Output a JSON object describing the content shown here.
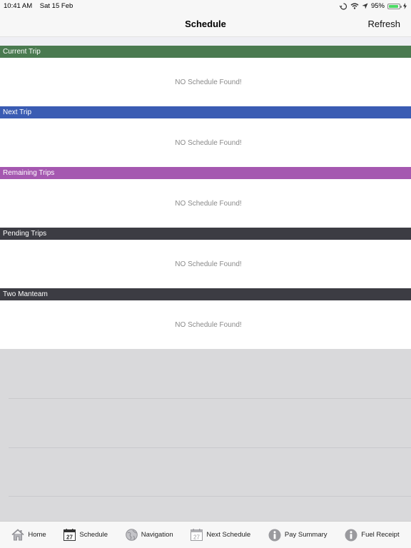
{
  "status_bar": {
    "time": "10:41 AM",
    "date": "Sat 15 Feb",
    "battery": "95%",
    "battery_level": 0.95
  },
  "nav": {
    "title": "Schedule",
    "refresh_label": "Refresh"
  },
  "sections": [
    {
      "title": "Current Trip",
      "color": "#4a7a50",
      "message": "NO Schedule Found!"
    },
    {
      "title": "Next Trip",
      "color": "#3a5cb3",
      "message": "NO Schedule Found!"
    },
    {
      "title": "Remaining Trips",
      "color": "#a558b0",
      "message": "NO Schedule Found!"
    },
    {
      "title": "Pending Trips",
      "color": "#3c3c43",
      "message": "NO Schedule Found!"
    },
    {
      "title": "Two Manteam",
      "color": "#3c3c43",
      "message": "NO Schedule Found!"
    }
  ],
  "tabs": [
    {
      "label": "Home",
      "icon": "home-icon"
    },
    {
      "label": "Schedule",
      "icon": "calendar-icon",
      "day": "27"
    },
    {
      "label": "Navigation",
      "icon": "globe-icon"
    },
    {
      "label": "Next Schedule",
      "icon": "calendar-icon",
      "day": "27"
    },
    {
      "label": "Pay Summary",
      "icon": "info-icon"
    },
    {
      "label": "Fuel Receipt",
      "icon": "info-icon"
    }
  ]
}
